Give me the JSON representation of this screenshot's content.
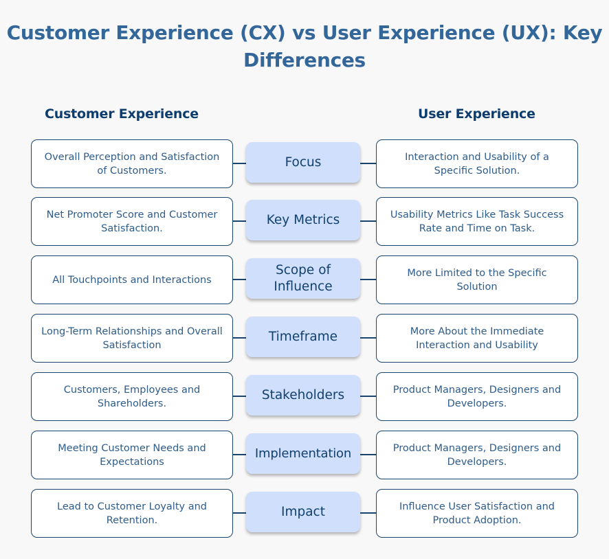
{
  "title": "Customer Experience (CX) vs User Experience (UX): Key Differences",
  "columns": {
    "left_heading": "Customer Experience",
    "right_heading": "User Experience"
  },
  "rows": [
    {
      "aspect": "Focus",
      "cx": "Overall Perception and Satisfaction of Customers.",
      "ux": "Interaction and Usability of a Specific Solution."
    },
    {
      "aspect": "Key Metrics",
      "cx": "Net Promoter Score and Customer Satisfaction.",
      "ux": "Usability Metrics Like Task Success Rate and Time on Task."
    },
    {
      "aspect": "Scope of\nInfluence",
      "cx": "All Touchpoints and Interactions",
      "ux": "More Limited to the Specific Solution"
    },
    {
      "aspect": "Timeframe",
      "cx": "Long-Term Relationships and Overall Satisfaction",
      "ux": "More About the Immediate Interaction and Usability"
    },
    {
      "aspect": "Stakeholders",
      "cx": "Customers, Employees and Shareholders.",
      "ux": "Product Managers, Designers and Developers."
    },
    {
      "aspect": "Implementation",
      "cx": "Meeting Customer Needs and Expectations",
      "ux": "Product Managers, Designers and Developers."
    },
    {
      "aspect": "Impact",
      "cx": "Lead to Customer Loyalty and Retention.",
      "ux": "Influence User Satisfaction and Product Adoption."
    }
  ],
  "colors": {
    "title": "#336699",
    "heading": "#0d3c6e",
    "box_border": "#1a4470",
    "box_text": "#2e5c8a",
    "pill_fill": "#d0e0fc",
    "pill_text": "#12406e",
    "background": "#f8f8f9"
  }
}
